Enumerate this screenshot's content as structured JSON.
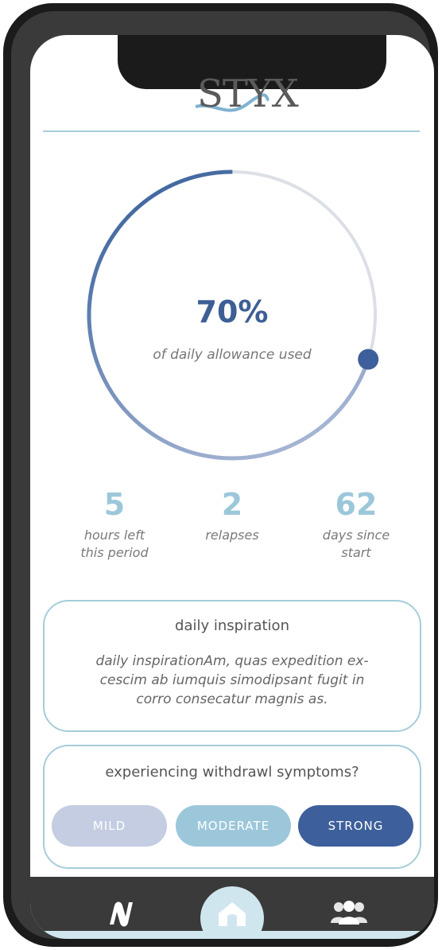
{
  "app": {
    "logo_text": "STYX"
  },
  "progress": {
    "fraction": 0.7,
    "percent_label": "70%",
    "caption": "of daily allowance used"
  },
  "stats": [
    {
      "value": "5",
      "label_line1": "hours left",
      "label_line2": "this period"
    },
    {
      "value": "2",
      "label_line1": "relapses",
      "label_line2": ""
    },
    {
      "value": "62",
      "label_line1": "days since",
      "label_line2": "start"
    }
  ],
  "inspiration": {
    "title": "daily inspiration",
    "line1": "daily inspirationAm, quas expedition ex-",
    "line2": "cescim ab iumquis simodipsant fugit in",
    "line3": "corro consecatur magnis as."
  },
  "symptoms": {
    "title": "experiencing withdrawl symptoms?",
    "buttons": [
      {
        "label": "MILD",
        "color": "#c4cde2"
      },
      {
        "label": "MODERATE",
        "color": "#9cc7da"
      },
      {
        "label": "STRONG",
        "color": "#3d5f9b"
      }
    ]
  },
  "nav": {
    "items": [
      {
        "name": "logo-n-icon"
      },
      {
        "name": "home-icon"
      },
      {
        "name": "community-icon"
      }
    ]
  },
  "colors": {
    "accent": "#3d5f94",
    "light_accent": "#9cc7da",
    "border": "#a6ccda"
  }
}
